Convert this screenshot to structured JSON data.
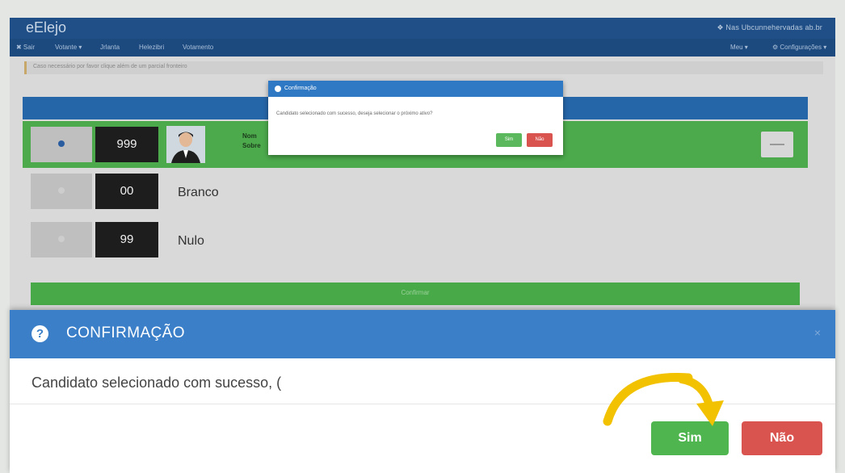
{
  "app": {
    "logo": "eElejo",
    "user_link": "❖ Nas Ubcunnehervadas ab.br"
  },
  "menu": {
    "left_items": [
      "✖ Sair",
      "Votante ▾",
      "Jrlanta",
      "Helezibri",
      "Votamento"
    ],
    "right_items": [
      "Meu ▾",
      "⚙ Configurações ▾"
    ]
  },
  "alert_text": "Caso necessário por favor clique além de um parcial fronteiro",
  "candidates": [
    {
      "number": "999",
      "label": "",
      "selected": true
    },
    {
      "number": "00",
      "label": "Branco",
      "selected": false
    },
    {
      "number": "99",
      "label": "Nulo",
      "selected": false
    }
  ],
  "selected_row_text": {
    "line1": "Nom",
    "line2": "Sobre"
  },
  "confirm_bar_label": "Confirmar",
  "mini_dialog": {
    "title": "Confirmação",
    "body": "Candidato selecionado com sucesso, deseja selecionar o próximo ativo?",
    "yes": "Sim",
    "no": "Não"
  },
  "zoom_dialog": {
    "title": "CONFIRMAÇÃO",
    "close": "×",
    "body": "Candidato selecionado com sucesso, (",
    "yes": "Sim",
    "no": "Não"
  },
  "colors": {
    "navbar": "#1f4f86",
    "success": "#4caa4c",
    "danger": "#d9534f",
    "dialog_header": "#3b7fc8",
    "arrow": "#f2c200"
  },
  "icons": {
    "question": "question-circle-icon",
    "arrow": "curved-arrow-icon"
  }
}
